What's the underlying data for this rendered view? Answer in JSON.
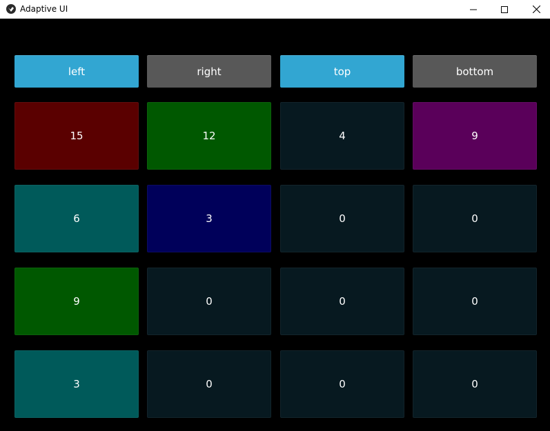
{
  "window": {
    "title": "Adaptive UI",
    "icon": "kivy-logo-icon",
    "controls": {
      "minimize": "minimize-icon",
      "maximize": "maximize-icon",
      "close": "close-icon"
    }
  },
  "colors": {
    "active_button": "#32a6d2",
    "inactive_button": "#585858",
    "empty_cell": "#071920",
    "red": "#5a0000",
    "green": "#005800",
    "purple": "#5a005a",
    "teal": "#005a5a",
    "navy": "#00005a"
  },
  "buttons": [
    {
      "label": "left",
      "state": "active"
    },
    {
      "label": "right",
      "state": "inactive"
    },
    {
      "label": "top",
      "state": "active"
    },
    {
      "label": "bottom",
      "state": "inactive"
    }
  ],
  "grid": [
    [
      {
        "value": "15",
        "color": "#5a0000"
      },
      {
        "value": "12",
        "color": "#005800"
      },
      {
        "value": "4",
        "color": "#071920"
      },
      {
        "value": "9",
        "color": "#5a005a"
      }
    ],
    [
      {
        "value": "6",
        "color": "#005a5a"
      },
      {
        "value": "3",
        "color": "#00005a"
      },
      {
        "value": "0",
        "color": "#071920"
      },
      {
        "value": "0",
        "color": "#071920"
      }
    ],
    [
      {
        "value": "9",
        "color": "#005800"
      },
      {
        "value": "0",
        "color": "#071920"
      },
      {
        "value": "0",
        "color": "#071920"
      },
      {
        "value": "0",
        "color": "#071920"
      }
    ],
    [
      {
        "value": "3",
        "color": "#005a5a"
      },
      {
        "value": "0",
        "color": "#071920"
      },
      {
        "value": "0",
        "color": "#071920"
      },
      {
        "value": "0",
        "color": "#071920"
      }
    ]
  ]
}
